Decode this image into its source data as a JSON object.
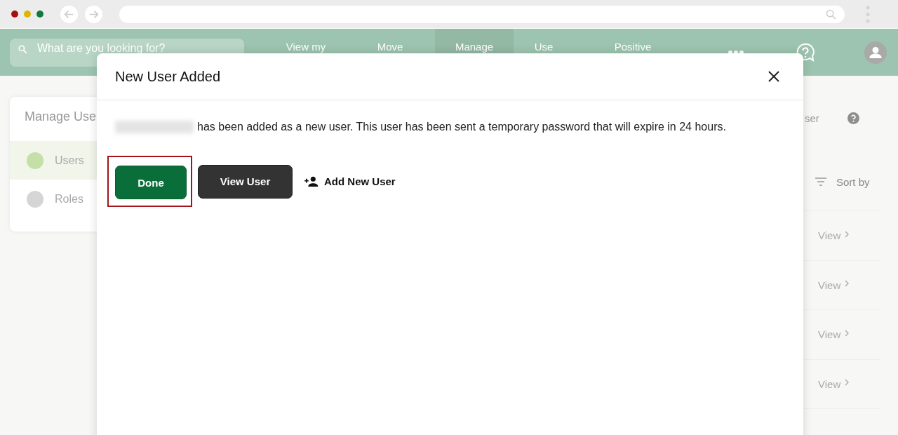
{
  "header": {
    "search": {
      "placeholder": "What are you looking for?"
    },
    "nav": [
      {
        "label": "View my",
        "selected": false
      },
      {
        "label": "Move",
        "selected": false
      },
      {
        "label": "Manage",
        "selected": true
      },
      {
        "label": "Use",
        "selected": false
      },
      {
        "label": "Positive",
        "selected": false
      }
    ]
  },
  "sidebar": {
    "title": "Manage Use",
    "items": [
      {
        "label": "Users",
        "selected": true
      },
      {
        "label": "Roles",
        "selected": false
      }
    ]
  },
  "right_panel": {
    "action": "ser",
    "sort": "Sort by",
    "rows": [
      {
        "link": "View"
      },
      {
        "link": "View"
      },
      {
        "link": "View"
      },
      {
        "link": "View"
      }
    ]
  },
  "dialog": {
    "title": "New User Added",
    "message": "has been added as a new user. This user has been sent a temporary password that will expire in 24 hours.",
    "buttons": [
      {
        "label": "Done",
        "kind": "primary",
        "highlighted": true
      },
      {
        "label": "View User",
        "kind": "secondary",
        "highlighted": false
      },
      {
        "label": "Add New User",
        "kind": "link",
        "highlighted": false
      }
    ]
  }
}
